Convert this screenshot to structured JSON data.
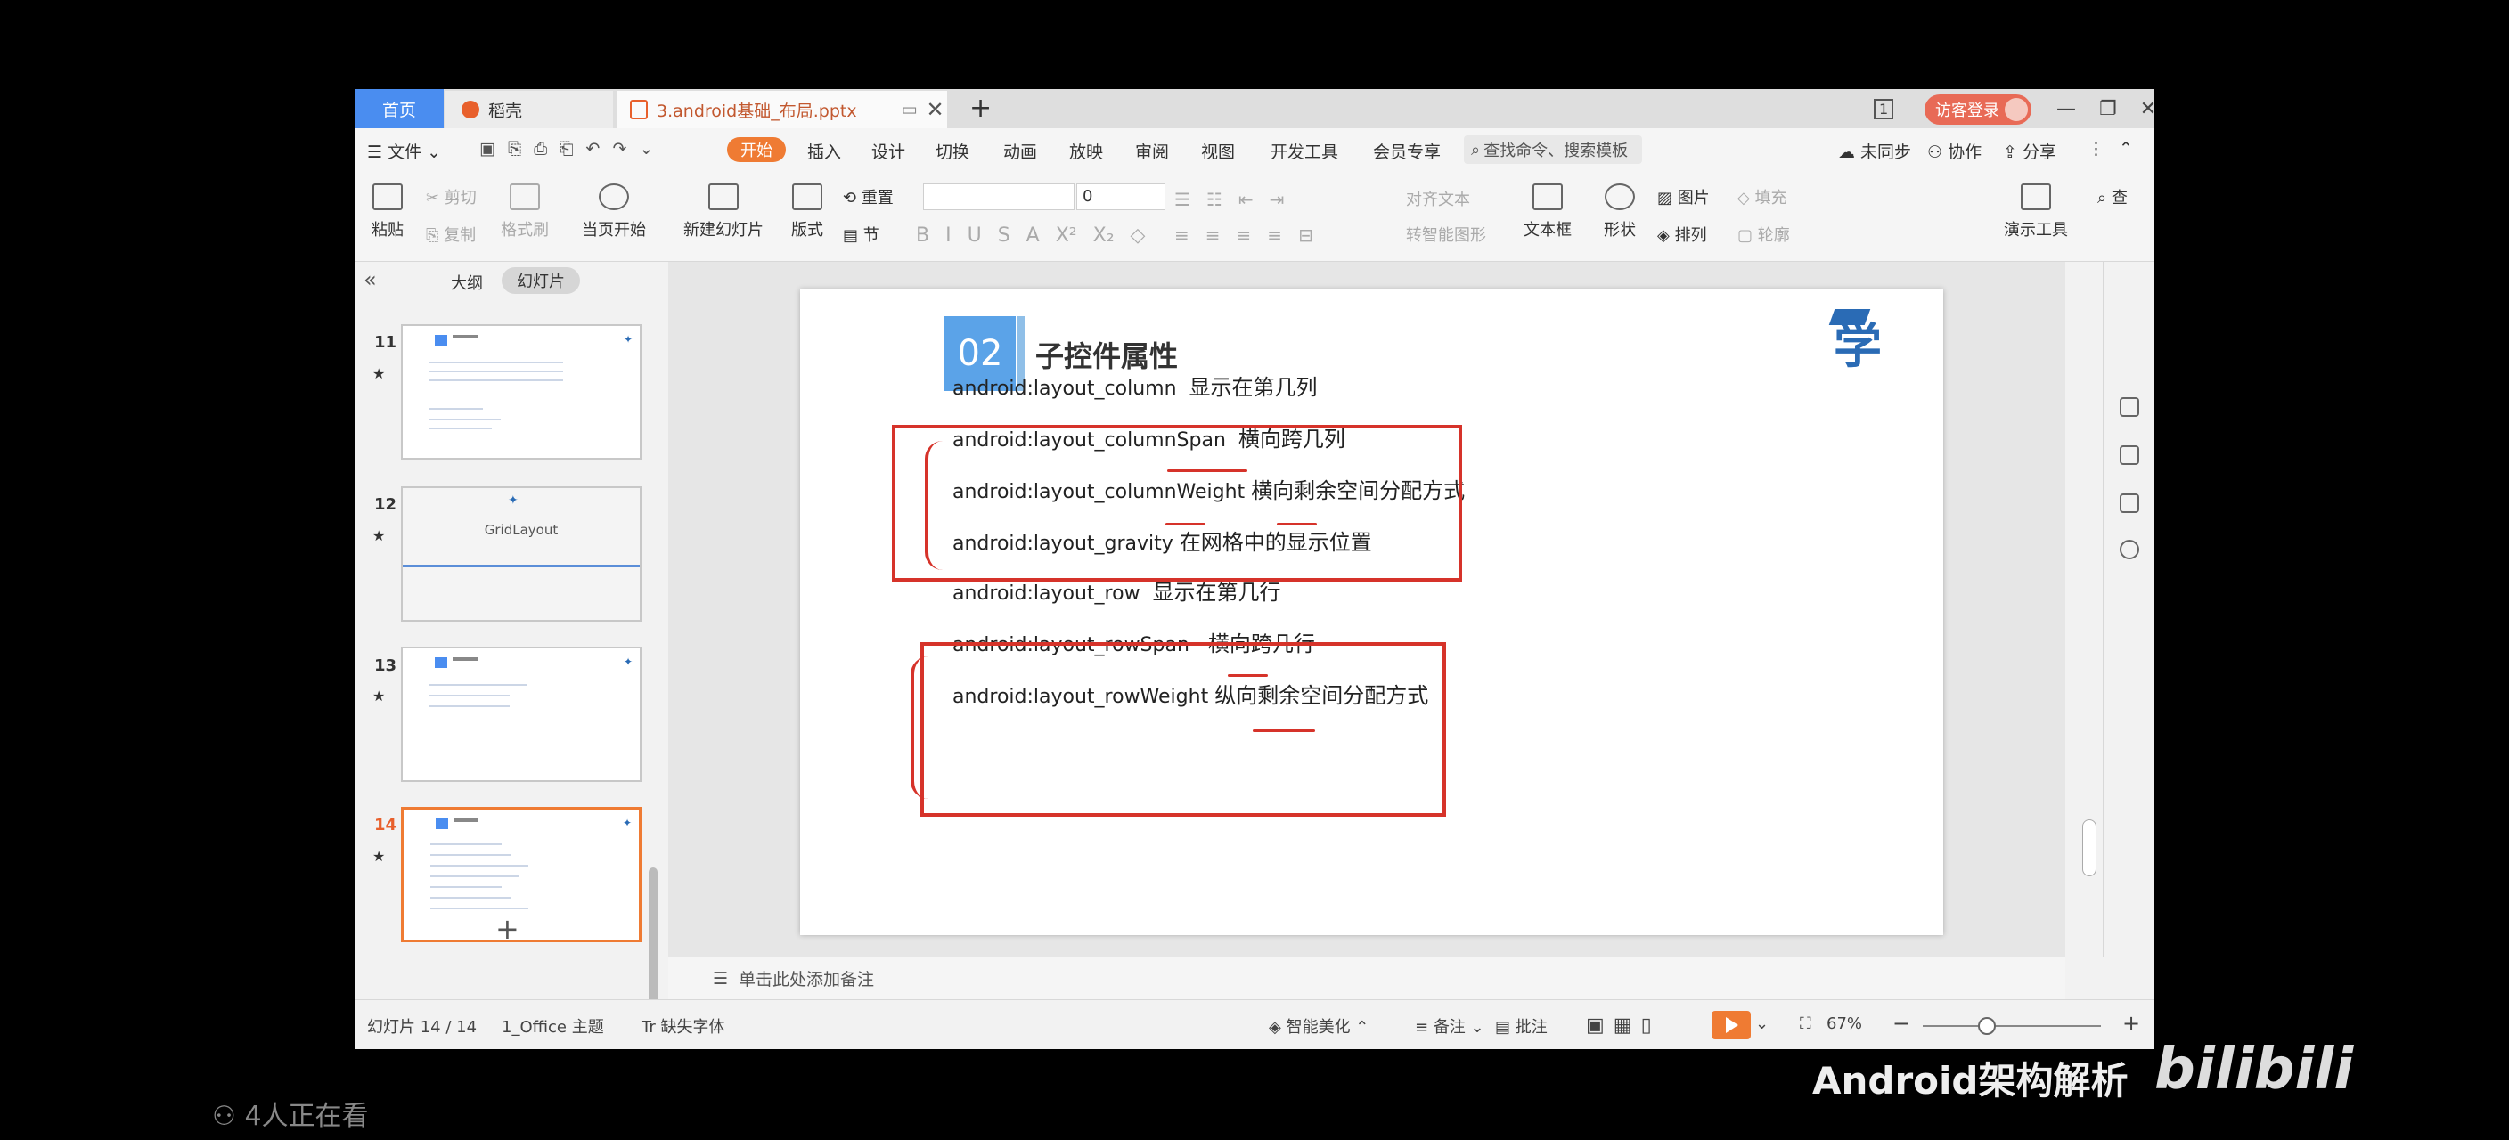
{
  "tabs": {
    "home": "首页",
    "daoke": "稻壳",
    "doc": "3.android基础_布局.pptx"
  },
  "titlebar": {
    "page_indicator": "1",
    "login": "访客登录"
  },
  "menu": {
    "file": "文件",
    "start": "开始",
    "items": [
      "插入",
      "设计",
      "切换",
      "动画",
      "放映",
      "审阅",
      "视图",
      "开发工具",
      "会员专享"
    ],
    "search": "查找命令、搜索模板",
    "unsynced": "未同步",
    "collab": "协作",
    "share": "分享"
  },
  "ribbon": {
    "paste": "粘贴",
    "cut": "剪切",
    "copy": "复制",
    "format_painter": "格式刷",
    "from_current": "当页开始",
    "new_slide": "新建幻灯片",
    "layout": "版式",
    "section": "节",
    "reset": "重置",
    "font_size": "0",
    "align_text": "对齐文本",
    "to_smartart": "转智能图形",
    "textbox": "文本框",
    "shape": "形状",
    "picture": "图片",
    "arrange": "排列",
    "fill": "填充",
    "outline": "轮廓",
    "present_tools": "演示工具",
    "find": "查"
  },
  "left_panel": {
    "outline": "大纲",
    "slides": "幻灯片",
    "thumbs": [
      {
        "num": "11"
      },
      {
        "num": "12",
        "title": "GridLayout"
      },
      {
        "num": "13"
      },
      {
        "num": "14"
      }
    ]
  },
  "slide": {
    "number": "02",
    "title": "子控件属性",
    "logo": "学",
    "attrs": [
      {
        "key": "android:layout_column",
        "desc": "显示在第几列"
      },
      {
        "key": "android:layout_columnSpan",
        "desc": "横向跨几列"
      },
      {
        "key": "android:layout_columnWeight",
        "desc": "横向剩余空间分配方式"
      },
      {
        "key": "android:layout_gravity",
        "desc": "在网格中的显示位置"
      },
      {
        "key": "android:layout_row",
        "desc": "显示在第几行"
      },
      {
        "key": "android:layout_rowSpan",
        "desc": "横向跨几行"
      },
      {
        "key": "android:layout_rowWeight",
        "desc": "纵向剩余空间分配方式"
      }
    ]
  },
  "notes_placeholder": "单击此处添加备注",
  "status": {
    "slide_count": "幻灯片 14 / 14",
    "theme": "1_Office 主题",
    "missing_font": "缺失字体",
    "beautify": "智能美化",
    "notes": "备注",
    "comments": "批注",
    "zoom": "67%"
  },
  "overlay": {
    "viewers": "4人正在看",
    "channel": "Android架构解析",
    "site": "bilibili"
  }
}
